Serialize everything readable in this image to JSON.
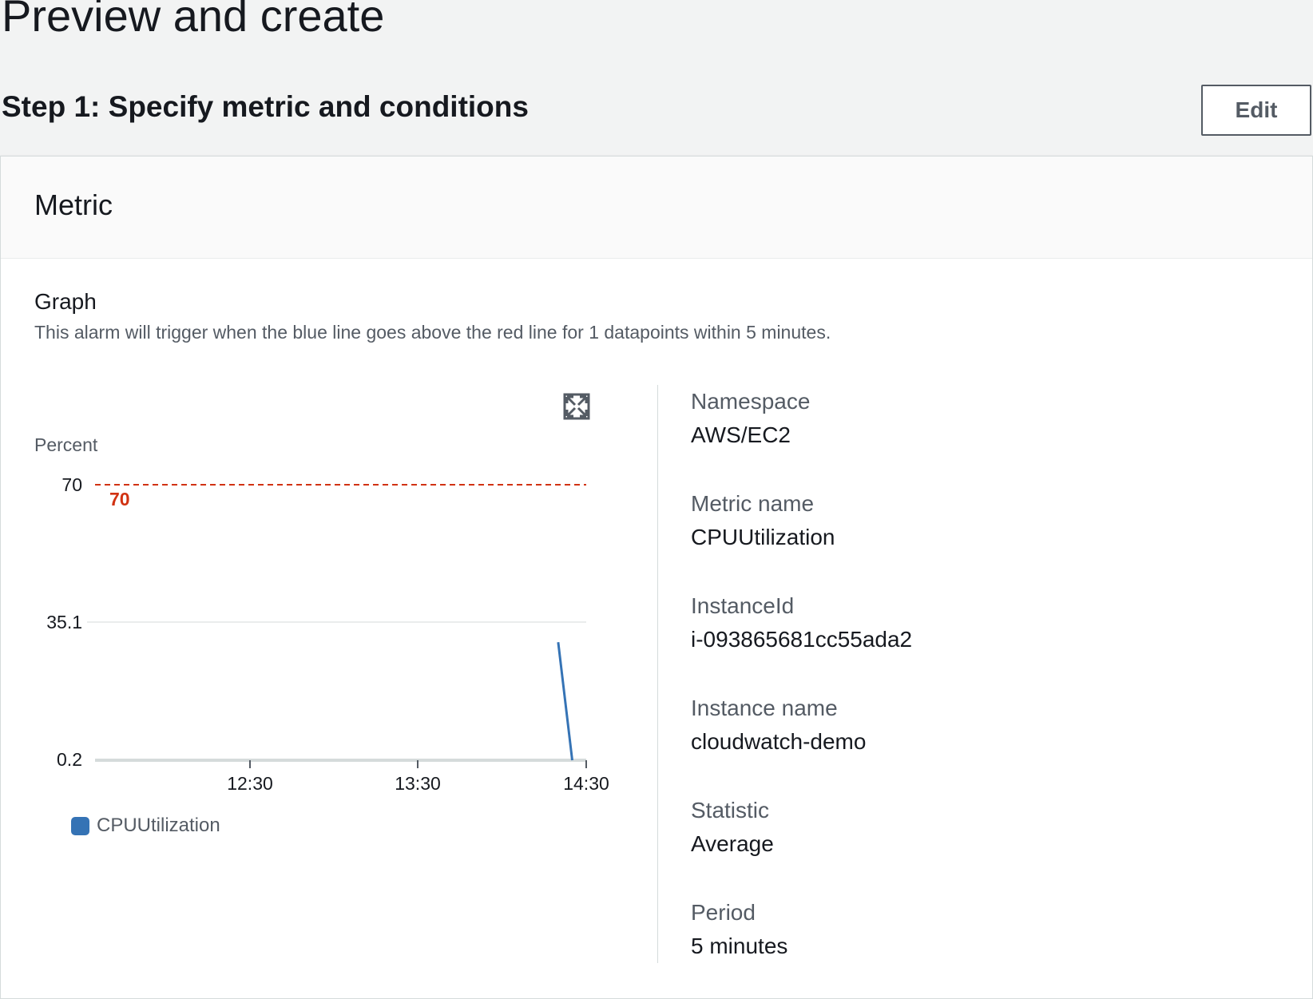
{
  "header": {
    "page_title": "Preview and create",
    "step_title": "Step 1: Specify metric and conditions",
    "edit_label": "Edit"
  },
  "panel": {
    "title": "Metric",
    "graph_title": "Graph",
    "graph_description": "This alarm will trigger when the blue line goes above the red line for 1 datapoints within 5 minutes.",
    "expand_icon": "expand-icon"
  },
  "chart_data": {
    "type": "line",
    "ylabel": "Percent",
    "yticks": [
      "70",
      "35.1",
      "0.2"
    ],
    "xticks": [
      "12:30",
      "13:30",
      "14:30"
    ],
    "threshold": {
      "value": 70,
      "label": "70",
      "color": "#d13212"
    },
    "series": [
      {
        "name": "CPUUtilization",
        "color": "#3573b5",
        "x": [
          "14:20",
          "14:25"
        ],
        "y": [
          30.1,
          0.2
        ]
      }
    ],
    "legend": [
      "CPUUtilization"
    ]
  },
  "details": [
    {
      "key": "Namespace",
      "value": "AWS/EC2"
    },
    {
      "key": "Metric name",
      "value": "CPUUtilization"
    },
    {
      "key": "InstanceId",
      "value": "i-093865681cc55ada2"
    },
    {
      "key": "Instance name",
      "value": "cloudwatch-demo"
    },
    {
      "key": "Statistic",
      "value": "Average"
    },
    {
      "key": "Period",
      "value": "5 minutes"
    }
  ]
}
